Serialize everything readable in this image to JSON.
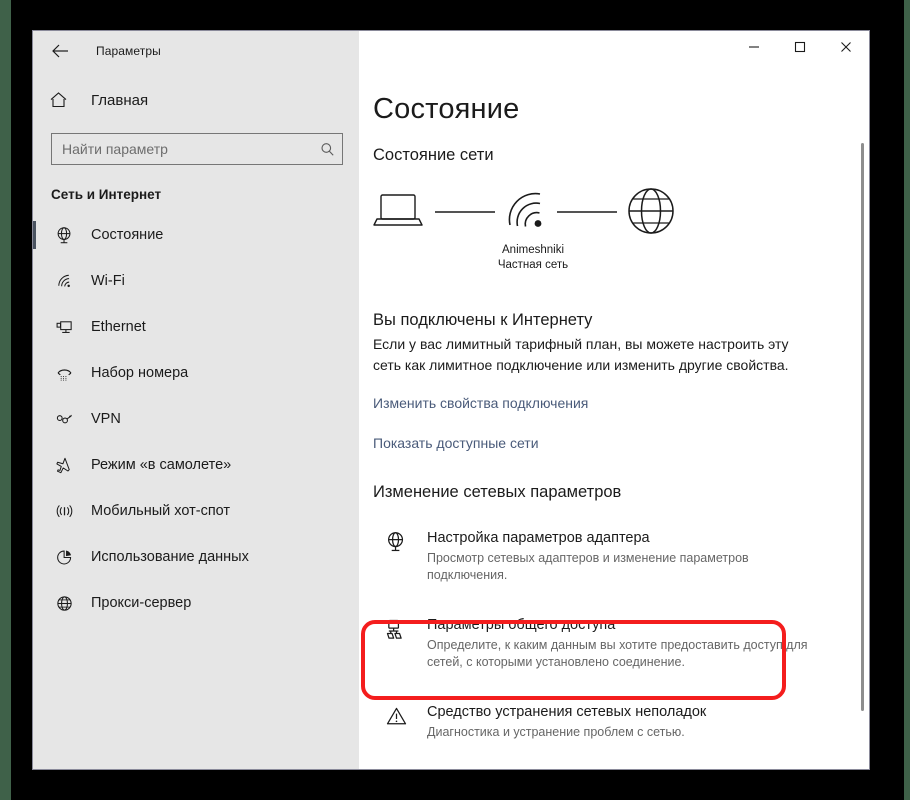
{
  "window": {
    "app_title": "Параметры",
    "back_icon": "back-arrow-icon",
    "controls": {
      "minimize": "minimize-icon",
      "maximize": "maximize-icon",
      "close": "close-icon"
    }
  },
  "sidebar": {
    "home": {
      "label": "Главная",
      "icon": "home-icon"
    },
    "search": {
      "placeholder": "Найти параметр",
      "value": "",
      "icon": "search-icon"
    },
    "group_title": "Сеть и Интернет",
    "items": [
      {
        "label": "Состояние",
        "icon": "globe-monitor-icon",
        "selected": true
      },
      {
        "label": "Wi-Fi",
        "icon": "wifi-icon",
        "selected": false
      },
      {
        "label": "Ethernet",
        "icon": "ethernet-icon",
        "selected": false
      },
      {
        "label": "Набор номера",
        "icon": "phone-dialup-icon",
        "selected": false
      },
      {
        "label": "VPN",
        "icon": "vpn-key-icon",
        "selected": false
      },
      {
        "label": "Режим «в самолете»",
        "icon": "airplane-icon",
        "selected": false
      },
      {
        "label": "Мобильный хот-спот",
        "icon": "hotspot-broadcast-icon",
        "selected": false
      },
      {
        "label": "Использование данных",
        "icon": "pie-chart-icon",
        "selected": false
      },
      {
        "label": "Прокси-сервер",
        "icon": "globe-icon",
        "selected": false
      }
    ]
  },
  "main": {
    "page_title": "Состояние",
    "network_status_head": "Состояние сети",
    "diagram": {
      "device_icon": "laptop-icon",
      "link_icon": "wifi-signal-icon",
      "internet_icon": "globe-icon",
      "network_name": "Animeshniki",
      "network_type": "Частная сеть"
    },
    "connection_title": "Вы подключены к Интернету",
    "connection_desc": "Если у вас лимитный тарифный план, вы можете настроить эту сеть как лимитное подключение или изменить другие свойства.",
    "links": [
      "Изменить свойства подключения",
      "Показать доступные сети"
    ],
    "change_settings_head": "Изменение сетевых параметров",
    "options": [
      {
        "title": "Настройка параметров адаптера",
        "subtitle": "Просмотр сетевых адаптеров и изменение параметров подключения.",
        "icon": "adapter-globe-icon",
        "highlighted": true
      },
      {
        "title": "Параметры общего доступа",
        "subtitle": "Определите, к каким данным вы хотите предоставить доступ для сетей, с которыми установлено соединение.",
        "icon": "sharing-folder-icon",
        "highlighted": false
      },
      {
        "title": "Средство устранения сетевых неполадок",
        "subtitle": "Диагностика и устранение проблем с сетью.",
        "icon": "warning-triangle-icon",
        "highlighted": false
      }
    ],
    "annotation": {
      "color": "#f41d1d",
      "target": "Настройка параметров адаптера"
    }
  },
  "scrollbar": {
    "name": "vertical-scrollbar"
  }
}
